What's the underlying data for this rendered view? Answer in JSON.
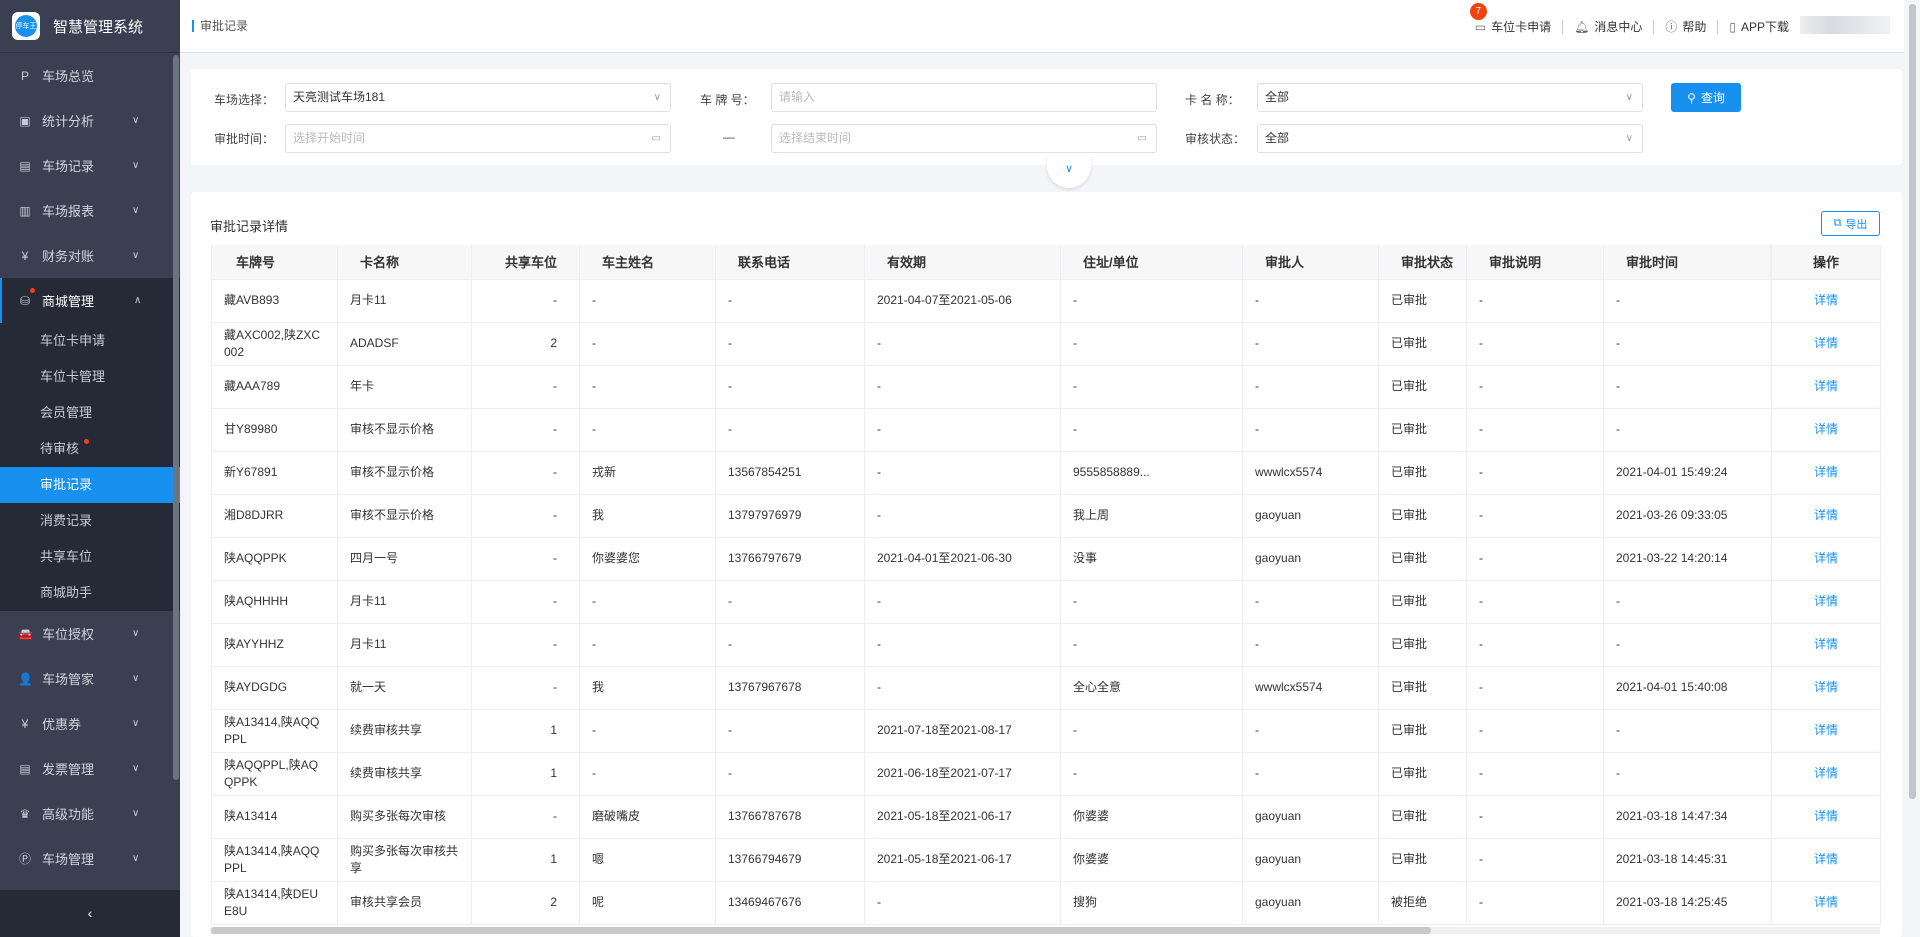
{
  "app": {
    "title": "智慧管理系统",
    "logo_text": "停车王"
  },
  "sidebar": {
    "items": [
      {
        "label": "车场总览",
        "icon": "P"
      },
      {
        "label": "统计分析",
        "icon": "▣"
      },
      {
        "label": "车场记录",
        "icon": "▤"
      },
      {
        "label": "车场报表",
        "icon": "▥"
      },
      {
        "label": "财务对账",
        "icon": "¥"
      },
      {
        "label": "商城管理",
        "icon": "⛁"
      }
    ],
    "submenu": [
      "车位卡申请",
      "车位卡管理",
      "会员管理",
      "待审核",
      "审批记录",
      "消费记录",
      "共享车位",
      "商城助手"
    ],
    "items_after": [
      {
        "label": "车位授权",
        "icon": "🚘"
      },
      {
        "label": "车场管家",
        "icon": "👤"
      },
      {
        "label": "优惠券",
        "icon": "¥"
      },
      {
        "label": "发票管理",
        "icon": "▤"
      },
      {
        "label": "高级功能",
        "icon": "♛"
      },
      {
        "label": "车场管理",
        "icon": "Ⓟ"
      }
    ],
    "collapse": "‹"
  },
  "header": {
    "breadcrumb": "审批记录",
    "card_apply": "车位卡申请",
    "card_apply_badge": "7",
    "messages": "消息中心",
    "help": "帮助",
    "app_download": "APP下载"
  },
  "filter": {
    "lot_label": "车场选择：",
    "lot_value": "天亮测试车场181",
    "plate_label": "车 牌 号：",
    "plate_placeholder": "请输入",
    "card_label": "卡 名 称：",
    "card_value": "全部",
    "time_label": "审批时间：",
    "start_placeholder": "选择开始时间",
    "dash": "—",
    "end_placeholder": "选择结束时间",
    "status_label": "审核状态：",
    "status_value": "全部",
    "query": "查询"
  },
  "table": {
    "title": "审批记录详情",
    "export": "导出",
    "columns": [
      "车牌号",
      "卡名称",
      "共享车位",
      "车主姓名",
      "联系电话",
      "有效期",
      "住址/单位",
      "审批人",
      "审批状态",
      "审批说明",
      "审批时间",
      "操作"
    ],
    "action": "详情",
    "rows": [
      [
        "藏AVB893",
        "月卡11",
        "-",
        "-",
        "-",
        "2021-04-07至2021-05-06",
        "-",
        "-",
        "已审批",
        "-",
        "-"
      ],
      [
        "藏AXC002,陕ZXC002",
        "ADADSF",
        "2",
        "-",
        "-",
        "-",
        "-",
        "-",
        "已审批",
        "-",
        "-"
      ],
      [
        "藏AAA789",
        "年卡",
        "-",
        "-",
        "-",
        "-",
        "-",
        "-",
        "已审批",
        "-",
        "-"
      ],
      [
        "甘Y89980",
        "审核不显示价格",
        "-",
        "-",
        "-",
        "-",
        "-",
        "-",
        "已审批",
        "-",
        "-"
      ],
      [
        "新Y67891",
        "审核不显示价格",
        "-",
        "戎新",
        "13567854251",
        "-",
        "9555858889...",
        "wwwlcx5574",
        "已审批",
        "-",
        "2021-04-01 15:49:24"
      ],
      [
        "湘D8DJRR",
        "审核不显示价格",
        "-",
        "我",
        "13797976979",
        "-",
        "我上周",
        "gaoyuan",
        "已审批",
        "-",
        "2021-03-26 09:33:05"
      ],
      [
        "陕AQQPPK",
        "四月一号",
        "-",
        "你婆婆您",
        "13766797679",
        "2021-04-01至2021-06-30",
        "没事",
        "gaoyuan",
        "已审批",
        "-",
        "2021-03-22 14:20:14"
      ],
      [
        "陕AQHHHH",
        "月卡11",
        "-",
        "-",
        "-",
        "-",
        "-",
        "-",
        "已审批",
        "-",
        "-"
      ],
      [
        "陕AYYHHZ",
        "月卡11",
        "-",
        "-",
        "-",
        "-",
        "-",
        "-",
        "已审批",
        "-",
        "-"
      ],
      [
        "陕AYDGDG",
        "就一天",
        "-",
        "我",
        "13767967678",
        "-",
        "全心全意",
        "wwwlcx5574",
        "已审批",
        "-",
        "2021-04-01 15:40:08"
      ],
      [
        "陕A13414,陕AQQPPL",
        "续费审核共享",
        "1",
        "-",
        "-",
        "2021-07-18至2021-08-17",
        "-",
        "-",
        "已审批",
        "-",
        "-"
      ],
      [
        "陕AQQPPL,陕AQQPPK",
        "续费审核共享",
        "1",
        "-",
        "-",
        "2021-06-18至2021-07-17",
        "-",
        "-",
        "已审批",
        "-",
        "-"
      ],
      [
        "陕A13414",
        "购买多张每次审核",
        "-",
        "磨破嘴皮",
        "13766787678",
        "2021-05-18至2021-06-17",
        "你婆婆",
        "gaoyuan",
        "已审批",
        "-",
        "2021-03-18 14:47:34"
      ],
      [
        "陕A13414,陕AQQPPL",
        "购买多张每次审核共享",
        "1",
        "嗯",
        "13766794679",
        "2021-05-18至2021-06-17",
        "你婆婆",
        "gaoyuan",
        "已审批",
        "-",
        "2021-03-18 14:45:31"
      ],
      [
        "陕A13414,陕DEUE8U",
        "审核共享会员",
        "2",
        "呢",
        "13469467676",
        "-",
        "搜狗",
        "gaoyuan",
        "被拒绝",
        "-",
        "2021-03-18 14:25:45"
      ]
    ]
  },
  "colors": {
    "accent": "#1890f0",
    "sidebar": "#3a4052",
    "submenu": "#262a36",
    "badge": "#f2420f"
  }
}
